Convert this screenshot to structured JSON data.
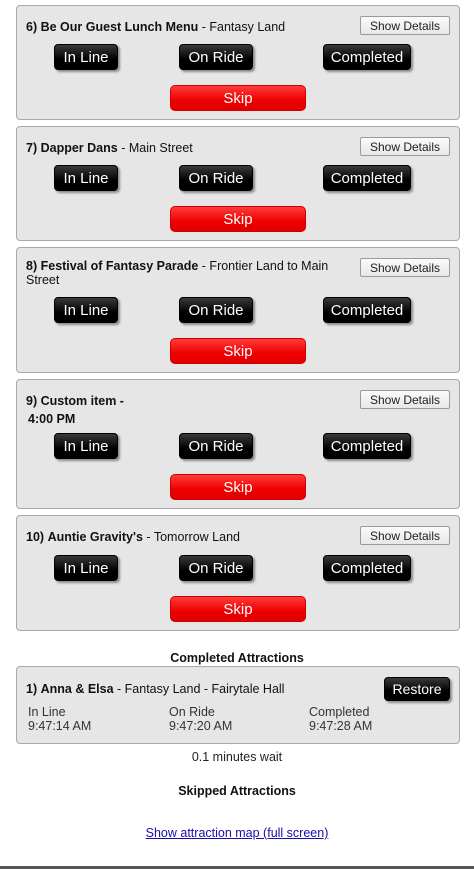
{
  "active_items": [
    {
      "number": "6)",
      "name": "Be Our Guest Lunch Menu",
      "location": "- Fantasy Land",
      "time": ""
    },
    {
      "number": "7)",
      "name": "Dapper Dans",
      "location": "- Main Street",
      "time": ""
    },
    {
      "number": "8)",
      "name": "Festival of Fantasy Parade",
      "location": "- Frontier Land to Main Street",
      "time": ""
    },
    {
      "number": "9)",
      "name": "Custom item",
      "location": "-",
      "time": "4:00 PM"
    },
    {
      "number": "10)",
      "name": "Auntie Gravity's",
      "location": "- Tomorrow Land",
      "time": ""
    }
  ],
  "buttons": {
    "show_details": "Show Details",
    "in_line": "In Line",
    "on_ride": "On Ride",
    "completed": "Completed",
    "skip": "Skip",
    "restore": "Restore"
  },
  "completed_section": {
    "heading": "Completed Attractions",
    "items": [
      {
        "number": "1)",
        "name": "Anna & Elsa",
        "location": "- Fantasy Land - Fairytale Hall",
        "in_line_label": "In Line",
        "in_line_time": "9:47:14 AM",
        "on_ride_label": "On Ride",
        "on_ride_time": "9:47:20 AM",
        "completed_label": "Completed",
        "completed_time": "9:47:28 AM"
      }
    ],
    "wait_text": "0.1 minutes wait"
  },
  "skipped_section": {
    "heading": "Skipped Attractions"
  },
  "map_link": "Show attraction map (full screen)",
  "colors": {
    "card_bg": "#e6e6e6",
    "skip_red": "#ee0000",
    "state_black": "#000000",
    "link_blue": "#1a0dab"
  }
}
